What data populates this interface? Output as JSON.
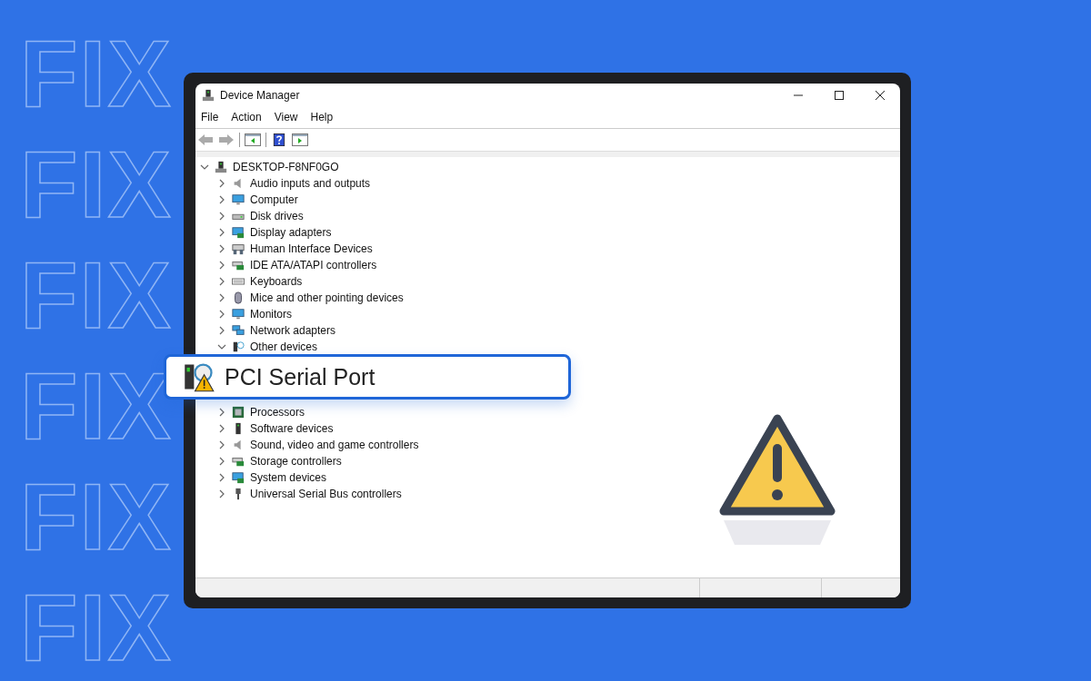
{
  "backdrop_words": [
    "FIX",
    "FIX",
    "FIX",
    "FIX",
    "FIX",
    "FIX"
  ],
  "window": {
    "title": "Device Manager"
  },
  "menu": [
    "File",
    "Action",
    "View",
    "Help"
  ],
  "toolbar": [
    {
      "kind": "back",
      "disabled": true
    },
    {
      "kind": "forward",
      "disabled": true
    },
    {
      "kind": "sep"
    },
    {
      "kind": "tree"
    },
    {
      "kind": "sep"
    },
    {
      "kind": "help"
    },
    {
      "kind": "pane"
    }
  ],
  "tree": {
    "label": "DESKTOP-F8NF0GO",
    "expanded": true,
    "children": [
      {
        "label": "Audio inputs and outputs",
        "kind": "speaker",
        "expanded": false
      },
      {
        "label": "Computer",
        "kind": "monitor",
        "expanded": false
      },
      {
        "label": "Disk drives",
        "kind": "disk",
        "expanded": false
      },
      {
        "label": "Display adapters",
        "kind": "display",
        "expanded": false
      },
      {
        "label": "Human Interface Devices",
        "kind": "hid",
        "expanded": false
      },
      {
        "label": "IDE ATA/ATAPI controllers",
        "kind": "card",
        "expanded": false
      },
      {
        "label": "Keyboards",
        "kind": "keyboard",
        "expanded": false
      },
      {
        "label": "Mice and other pointing devices",
        "kind": "mouse",
        "expanded": false
      },
      {
        "label": "Monitors",
        "kind": "monitor",
        "expanded": false
      },
      {
        "label": "Network adapters",
        "kind": "network",
        "expanded": false
      },
      {
        "label": "Other devices",
        "kind": "unknown",
        "expanded": true
      },
      {
        "label": "Processors",
        "kind": "chip",
        "expanded": false
      },
      {
        "label": "Software devices",
        "kind": "tower",
        "expanded": false
      },
      {
        "label": "Sound, video and game controllers",
        "kind": "speaker",
        "expanded": false
      },
      {
        "label": "Storage controllers",
        "kind": "card",
        "expanded": false
      },
      {
        "label": "System devices",
        "kind": "display",
        "expanded": false
      },
      {
        "label": "Universal Serial Bus controllers",
        "kind": "usb",
        "expanded": false
      }
    ]
  },
  "callout": {
    "label": "PCI Serial Port"
  }
}
